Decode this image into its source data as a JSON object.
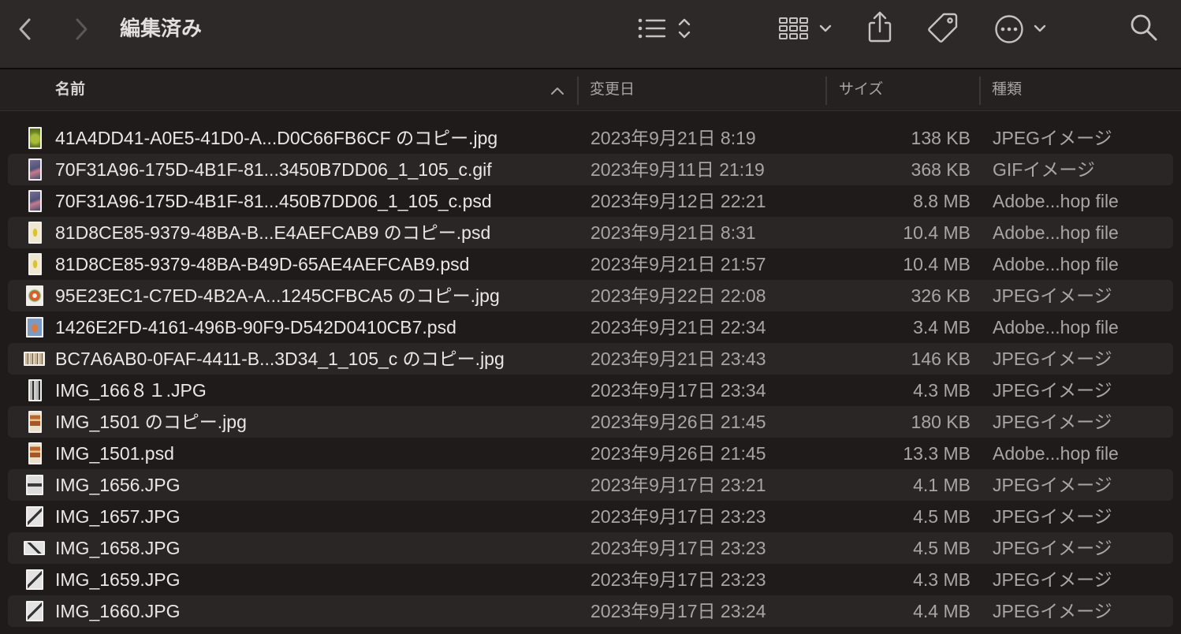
{
  "theme": {
    "toolbar_bg": "#2d2928",
    "header_bg": "#252120",
    "list_bg": "#1f1b1a",
    "stripe_bg": "#2a2625"
  },
  "window": {
    "title": "編集済み",
    "toolbar": {
      "back_icon": "chevron-left-icon",
      "forward_icon": "chevron-right-icon",
      "view_icon": "list-view-icon",
      "view_menu_icon": "chevron-up-down-icon",
      "group_icon": "grid-group-icon",
      "group_menu_icon": "chevron-down-icon",
      "share_icon": "share-icon",
      "tag_icon": "tag-icon",
      "more_icon": "ellipsis-circle-icon",
      "more_menu_icon": "chevron-down-icon",
      "search_icon": "search-icon"
    }
  },
  "columns": [
    {
      "label": "名前",
      "sorted": "ascending",
      "sort_icon": "chevron-up-icon"
    },
    {
      "label": "変更日"
    },
    {
      "label": "サイズ"
    },
    {
      "label": "種類"
    }
  ],
  "rows": [
    {
      "name": "41A4DD41-A0E5-41D0-A...D0C66FB6CF のコピー.jpg",
      "modified": "2023年9月21日 8:19",
      "size": "138 KB",
      "kind": "JPEGイメージ",
      "icon": "image-thumbnail-icon"
    },
    {
      "name": "70F31A96-175D-4B1F-81...3450B7DD06_1_105_c.gif",
      "modified": "2023年9月11日 21:19",
      "size": "368 KB",
      "kind": "GIFイメージ",
      "icon": "image-thumbnail-icon"
    },
    {
      "name": "70F31A96-175D-4B1F-81...450B7DD06_1_105_c.psd",
      "modified": "2023年9月12日 22:21",
      "size": "8.8 MB",
      "kind": "Adobe...hop file",
      "icon": "image-thumbnail-icon"
    },
    {
      "name": "81D8CE85-9379-48BA-B...E4AEFCAB9 のコピー.psd",
      "modified": "2023年9月21日 8:31",
      "size": "10.4 MB",
      "kind": "Adobe...hop file",
      "icon": "image-thumbnail-icon"
    },
    {
      "name": "81D8CE85-9379-48BA-B49D-65AE4AEFCAB9.psd",
      "modified": "2023年9月21日 21:57",
      "size": "10.4 MB",
      "kind": "Adobe...hop file",
      "icon": "image-thumbnail-icon"
    },
    {
      "name": "95E23EC1-C7ED-4B2A-A...1245CFBCA5 のコピー.jpg",
      "modified": "2023年9月22日 22:08",
      "size": "326 KB",
      "kind": "JPEGイメージ",
      "icon": "image-thumbnail-icon"
    },
    {
      "name": "1426E2FD-4161-496B-90F9-D542D0410CB7.psd",
      "modified": "2023年9月21日 22:34",
      "size": "3.4 MB",
      "kind": "Adobe...hop file",
      "icon": "image-thumbnail-icon"
    },
    {
      "name": "BC7A6AB0-0FAF-4411-B...3D34_1_105_c のコピー.jpg",
      "modified": "2023年9月21日 23:43",
      "size": "146 KB",
      "kind": "JPEGイメージ",
      "icon": "image-thumbnail-icon"
    },
    {
      "name": "IMG_166８１.JPG",
      "modified": "2023年9月17日 23:34",
      "size": "4.3 MB",
      "kind": "JPEGイメージ",
      "icon": "image-thumbnail-icon"
    },
    {
      "name": "IMG_1501 のコピー.jpg",
      "modified": "2023年9月26日 21:45",
      "size": "180 KB",
      "kind": "JPEGイメージ",
      "icon": "image-thumbnail-icon"
    },
    {
      "name": "IMG_1501.psd",
      "modified": "2023年9月26日 21:45",
      "size": "13.3 MB",
      "kind": "Adobe...hop file",
      "icon": "image-thumbnail-icon"
    },
    {
      "name": "IMG_1656.JPG",
      "modified": "2023年9月17日 23:21",
      "size": "4.1 MB",
      "kind": "JPEGイメージ",
      "icon": "image-thumbnail-icon"
    },
    {
      "name": "IMG_1657.JPG",
      "modified": "2023年9月17日 23:23",
      "size": "4.5 MB",
      "kind": "JPEGイメージ",
      "icon": "image-thumbnail-icon"
    },
    {
      "name": "IMG_1658.JPG",
      "modified": "2023年9月17日 23:23",
      "size": "4.5 MB",
      "kind": "JPEGイメージ",
      "icon": "image-thumbnail-icon"
    },
    {
      "name": "IMG_1659.JPG",
      "modified": "2023年9月17日 23:23",
      "size": "4.3 MB",
      "kind": "JPEGイメージ",
      "icon": "image-thumbnail-icon"
    },
    {
      "name": "IMG_1660.JPG",
      "modified": "2023年9月17日 23:24",
      "size": "4.4 MB",
      "kind": "JPEGイメージ",
      "icon": "image-thumbnail-icon"
    }
  ]
}
